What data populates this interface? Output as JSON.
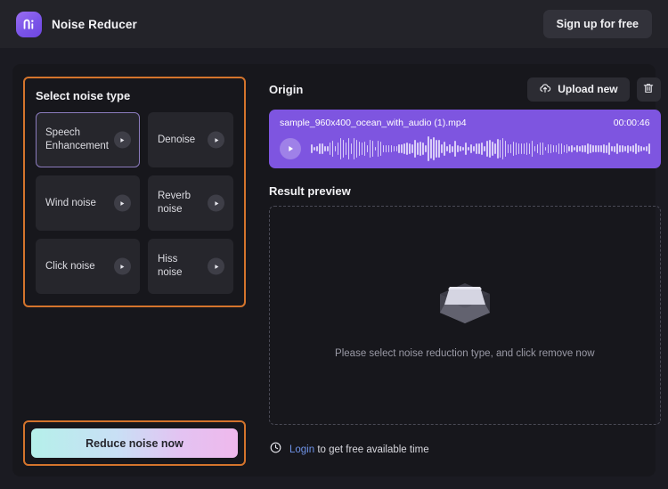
{
  "header": {
    "logo_icon": "media-io-logo-icon",
    "title": "Noise Reducer",
    "signup_label": "Sign up for free"
  },
  "noise_panel": {
    "title": "Select noise type",
    "highlight_color": "#d4742c",
    "selected_index": 0,
    "cards": [
      {
        "label": "Speech Enhancement",
        "icon": "play-icon",
        "selected": true
      },
      {
        "label": "Denoise",
        "icon": "play-icon",
        "selected": false
      },
      {
        "label": "Wind noise",
        "icon": "play-icon",
        "selected": false
      },
      {
        "label": "Reverb noise",
        "icon": "play-icon",
        "selected": false
      },
      {
        "label": "Click noise",
        "icon": "play-icon",
        "selected": false
      },
      {
        "label": "Hiss noise",
        "icon": "play-icon",
        "selected": false
      }
    ]
  },
  "action": {
    "reduce_label": "Reduce noise now",
    "gradient_from": "#b5f0ea",
    "gradient_to": "#efb8ec"
  },
  "origin": {
    "title": "Origin",
    "upload_label": "Upload new",
    "upload_icon": "cloud-upload-icon",
    "delete_icon": "trash-icon",
    "player": {
      "filename": "sample_960x400_ocean_with_audio (1).mp4",
      "duration": "00:00:46",
      "play_icon": "play-icon",
      "background": "#7e55e0"
    }
  },
  "result": {
    "title": "Result preview",
    "empty_icon": "empty-box-icon",
    "empty_text": "Please select noise reduction type, and click remove now"
  },
  "footer": {
    "clock_icon": "clock-icon",
    "link_label": "Login",
    "text": " to get free available time",
    "link_color": "#6f93e8"
  }
}
